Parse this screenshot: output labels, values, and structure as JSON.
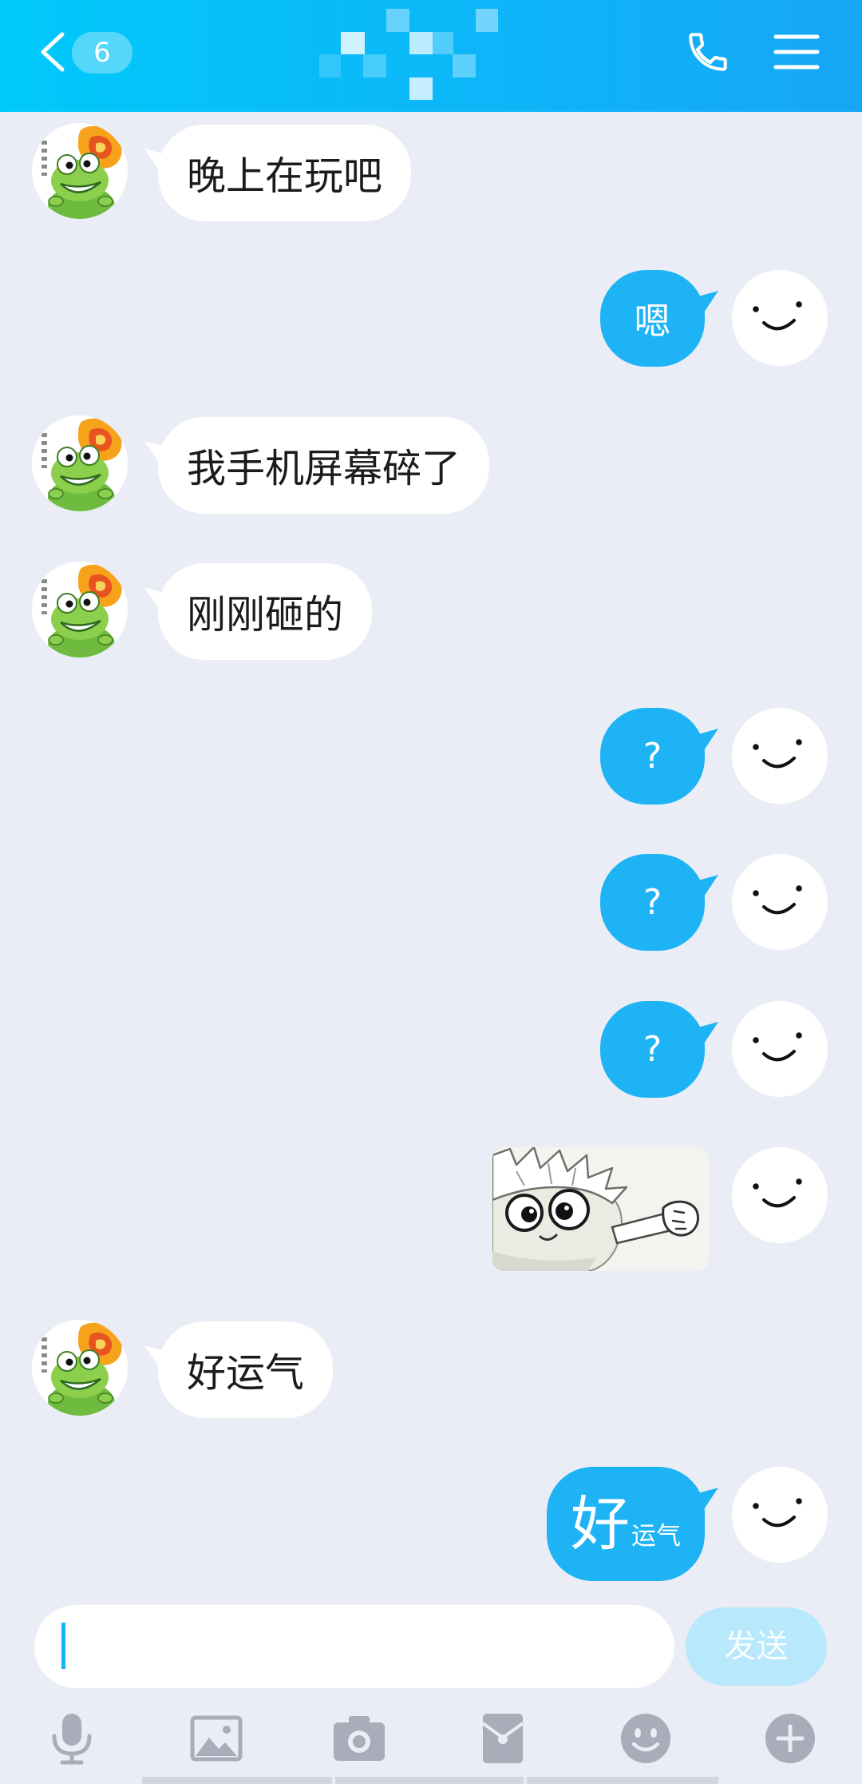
{
  "header": {
    "back_icon": "chevron-left-icon",
    "unread_count": "6",
    "call_icon": "phone-icon",
    "menu_icon": "menu-icon"
  },
  "avatars": {
    "contact": "frog-avatar-icon",
    "self": "smiley-avatar-icon"
  },
  "colors": {
    "header_gradient_start": "#00c9fb",
    "header_gradient_end": "#17a6f6",
    "chat_background": "#eaedf5",
    "outgoing_bubble": "#1db3f5",
    "incoming_bubble": "#ffffff",
    "send_button": "#b8e8fb",
    "toolbar_icon": "#a8adb9"
  },
  "messages": [
    {
      "side": "left",
      "type": "text",
      "text": "晚上在玩吧"
    },
    {
      "side": "right",
      "type": "text",
      "text": "嗯"
    },
    {
      "side": "left",
      "type": "text",
      "text": "我手机屏幕碎了"
    },
    {
      "side": "left",
      "type": "text",
      "text": "刚刚砸的"
    },
    {
      "side": "right",
      "type": "text",
      "text": "?"
    },
    {
      "side": "right",
      "type": "text",
      "text": "?"
    },
    {
      "side": "right",
      "type": "text",
      "text": "?"
    },
    {
      "side": "right",
      "type": "sticker",
      "sticker": "anime-peeking-sticker"
    },
    {
      "side": "left",
      "type": "text",
      "text": "好运气"
    },
    {
      "side": "right",
      "type": "styled-text",
      "large_text": "好",
      "small_text": "运气"
    }
  ],
  "input": {
    "value": "",
    "send_label": "发送"
  },
  "toolbar": {
    "items": [
      "microphone-icon",
      "image-icon",
      "camera-icon",
      "red-packet-icon",
      "emoji-icon",
      "plus-icon"
    ]
  }
}
